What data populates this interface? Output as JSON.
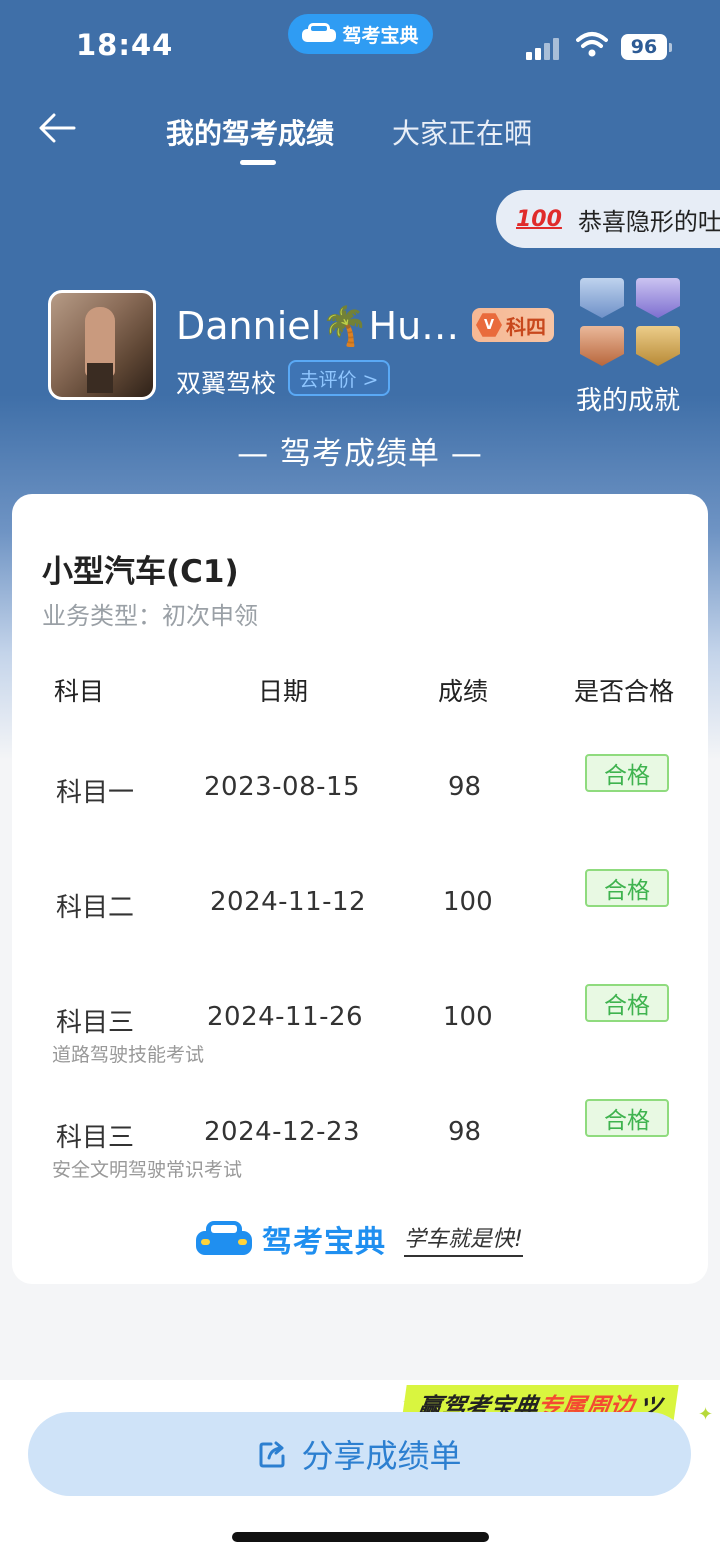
{
  "status_bar": {
    "time": "18:44",
    "battery": "96"
  },
  "app_pill": {
    "label": "驾考宝典"
  },
  "nav": {
    "tab_mine": "我的驾考成绩",
    "tab_others": "大家正在晒"
  },
  "ticker": {
    "text": "恭喜隐形的吐司"
  },
  "profile": {
    "name": "Danniel🌴Hu…",
    "level": "科四",
    "school": "双翼驾校",
    "review_button": "去评价 >",
    "achievements": "我的成就"
  },
  "report": {
    "heading": "— 驾考成绩单 —",
    "vehicle": "小型汽车(C1)",
    "business_type": "业务类型：初次申领",
    "columns": [
      "科目",
      "日期",
      "成绩",
      "是否合格"
    ],
    "rows": [
      {
        "subject": "科目一",
        "date": "2023-08-15",
        "score": "98",
        "result": "合格",
        "note": ""
      },
      {
        "subject": "科目二",
        "date": "2024-11-12",
        "score": "100",
        "result": "合格",
        "note": ""
      },
      {
        "subject": "科目三",
        "date": "2024-11-26",
        "score": "100",
        "result": "合格",
        "note": "道路驾驶技能考试"
      },
      {
        "subject": "科目三",
        "date": "2024-12-23",
        "score": "98",
        "result": "合格",
        "note": "安全文明驾驶常识考试"
      }
    ]
  },
  "brand": {
    "name": "驾考宝典",
    "slogan": "学车就是快!"
  },
  "promo": {
    "part1": "赢驾考宝典",
    "part2": "专属周边"
  },
  "share_button": {
    "label": "分享成绩单"
  },
  "colors": {
    "header_blue": "#3f6fa8",
    "pass_green": "#3fb34f",
    "brand_blue": "#1f8ff0",
    "share_text": "#2c7fd0"
  }
}
